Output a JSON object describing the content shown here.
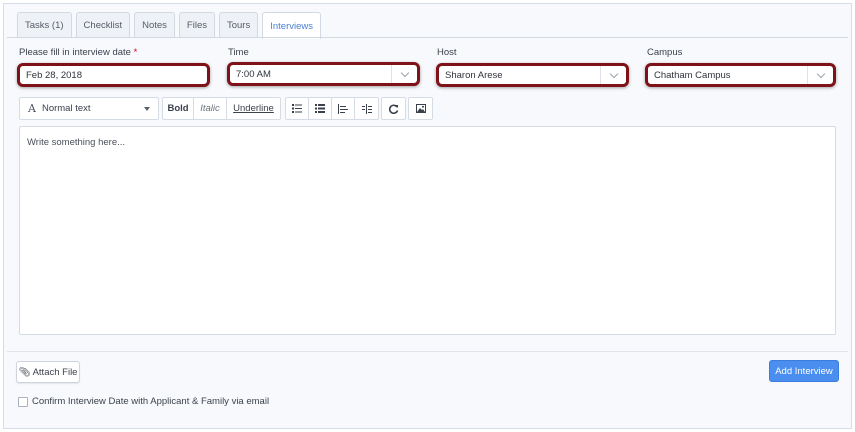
{
  "tabs": [
    {
      "label": "Tasks (1)"
    },
    {
      "label": "Checklist"
    },
    {
      "label": "Notes"
    },
    {
      "label": "Files"
    },
    {
      "label": "Tours"
    },
    {
      "label": "Interviews",
      "active": true
    }
  ],
  "form": {
    "date": {
      "label": "Please fill in interview date",
      "required_mark": "*",
      "value": "Feb 28, 2018"
    },
    "time": {
      "label": "Time",
      "value": "7:00 AM"
    },
    "host": {
      "label": "Host",
      "value": "Sharon Arese"
    },
    "campus": {
      "label": "Campus",
      "value": "Chatham Campus"
    }
  },
  "toolbar": {
    "format_select": "Normal text",
    "bold": "Bold",
    "italic": "Italic",
    "underline": "Underline"
  },
  "editor": {
    "placeholder": "Write something here..."
  },
  "footer": {
    "attach_label": "Attach File",
    "add_label": "Add Interview",
    "confirm_label": "Confirm Interview Date with Applicant & Family via email"
  },
  "colors": {
    "accent": "#4a8ef0",
    "highlight_border": "#7e1218",
    "required": "#d0021b"
  }
}
